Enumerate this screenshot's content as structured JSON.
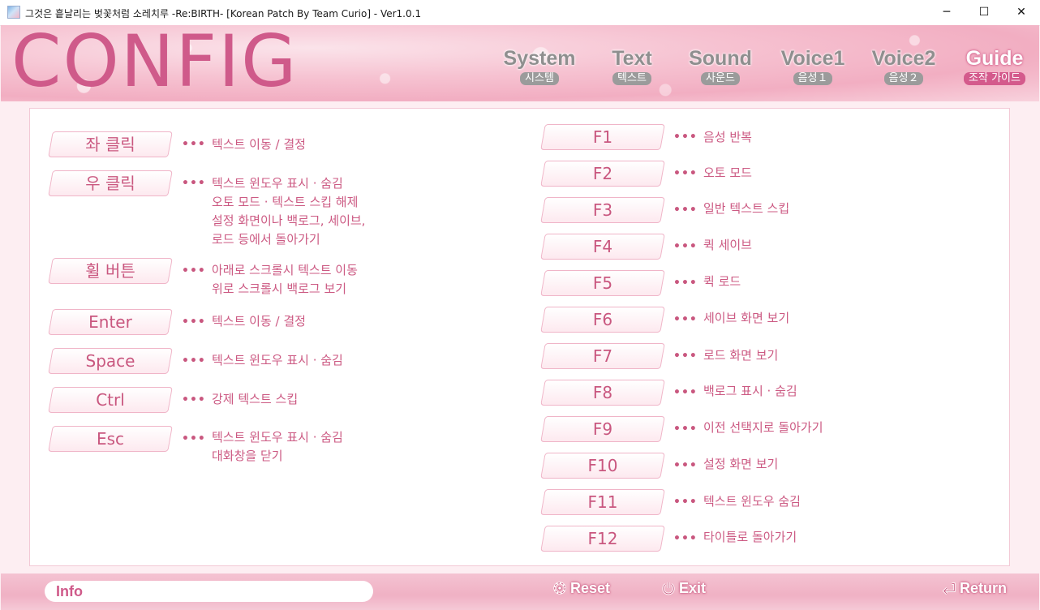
{
  "window": {
    "title": "그것은 흩날리는 벚꽃처럼 소레치루 -Re:BIRTH- [Korean Patch By Team Curio] - Ver1.0.1",
    "minimize": "─",
    "maximize": "☐",
    "close": "✕"
  },
  "header": {
    "title": "CONFIG",
    "tabs": [
      {
        "en": "System",
        "ko": "시스템"
      },
      {
        "en": "Text",
        "ko": "텍스트"
      },
      {
        "en": "Sound",
        "ko": "사운드"
      },
      {
        "en": "Voice1",
        "ko": "음성１"
      },
      {
        "en": "Voice2",
        "ko": "음성２"
      },
      {
        "en": "Guide",
        "ko": "조작 가이드"
      }
    ],
    "active_tab": "Guide"
  },
  "guide": {
    "dots": "•••",
    "left": [
      {
        "key": "좌 클릭",
        "desc": [
          "텍스트 이동 / 결정"
        ]
      },
      {
        "key": "우 클릭",
        "desc": [
          "텍스트 윈도우 표시 · 숨김",
          "오토 모드 · 텍스트 스킵 해제",
          "설정 화면이나 백로그, 세이브,",
          "로드 등에서 돌아가기"
        ]
      },
      {
        "key": "휠 버튼",
        "desc": [
          "아래로 스크롤시 텍스트 이동",
          "위로 스크롤시 백로그 보기"
        ]
      },
      {
        "key": "Enter",
        "desc": [
          "텍스트 이동 / 결정"
        ]
      },
      {
        "key": "Space",
        "desc": [
          "텍스트 윈도우 표시 · 숨김"
        ]
      },
      {
        "key": "Ctrl",
        "desc": [
          "강제 텍스트 스킵"
        ]
      },
      {
        "key": "Esc",
        "desc": [
          "텍스트 윈도우 표시 · 숨김",
          "대화창을 닫기"
        ]
      }
    ],
    "right": [
      {
        "key": "F1",
        "desc": "음성 반복"
      },
      {
        "key": "F2",
        "desc": "오토 모드"
      },
      {
        "key": "F3",
        "desc": "일반 텍스트 스킵"
      },
      {
        "key": "F4",
        "desc": "퀵 세이브"
      },
      {
        "key": "F5",
        "desc": "퀵 로드"
      },
      {
        "key": "F6",
        "desc": "세이브 화면 보기"
      },
      {
        "key": "F7",
        "desc": "로드 화면 보기"
      },
      {
        "key": "F8",
        "desc": "백로그 표시 · 숨김"
      },
      {
        "key": "F9",
        "desc": "이전 선택지로 돌아가기"
      },
      {
        "key": "F10",
        "desc": "설정 화면 보기"
      },
      {
        "key": "F11",
        "desc": "텍스트 윈도우 숨김"
      },
      {
        "key": "F12",
        "desc": "타이틀로 돌아가기"
      }
    ]
  },
  "footer": {
    "info": "Info",
    "reset": "Reset",
    "exit": "Exit",
    "return": "Return"
  }
}
